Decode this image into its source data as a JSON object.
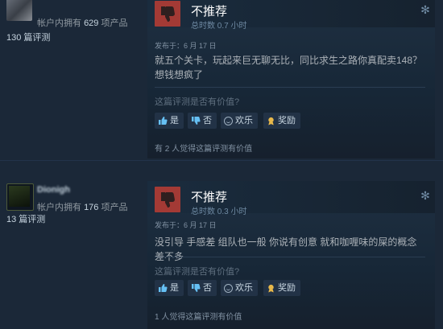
{
  "reviews": [
    {
      "username": "",
      "owns_prefix": "帐户内拥有",
      "owns_count": "629",
      "owns_suffix": "项产品",
      "review_count": "130 篇评测",
      "verdict": "不推荐",
      "hours": "总时数 0.7 小时",
      "posted": "发布于：6 月 17 日",
      "text": "就五个关卡，玩起来巨无聊无比，同比求生之路你真配卖148？想钱想疯了",
      "helpful_question": "这篇评测是否有价值?",
      "buttons": {
        "yes": "是",
        "no": "否",
        "funny": "欢乐",
        "award": "奖励"
      },
      "found_helpful": "有 2 人觉得这篇评测有价值"
    },
    {
      "username": "Dionigh",
      "owns_prefix": "帐户内拥有",
      "owns_count": "176",
      "owns_suffix": "项产品",
      "review_count": "13 篇评测",
      "verdict": "不推荐",
      "hours": "总时数 0.3 小时",
      "posted": "发布于：6 月 17 日",
      "text": "没引导 手感差 组队也一般 你说有创意 就和咖喱味的屎的概念差不多",
      "helpful_question": "这篇评测是否有价值?",
      "buttons": {
        "yes": "是",
        "no": "否",
        "funny": "欢乐",
        "award": "奖励"
      },
      "found_helpful": "1 人觉得这篇评测有价值"
    }
  ],
  "colors": {
    "thumb_down_bg": "#a33a35",
    "page_bg": "#1b2838"
  },
  "icons": {
    "thumb_down": "thumbs-down-icon",
    "options": "gear-icon"
  }
}
